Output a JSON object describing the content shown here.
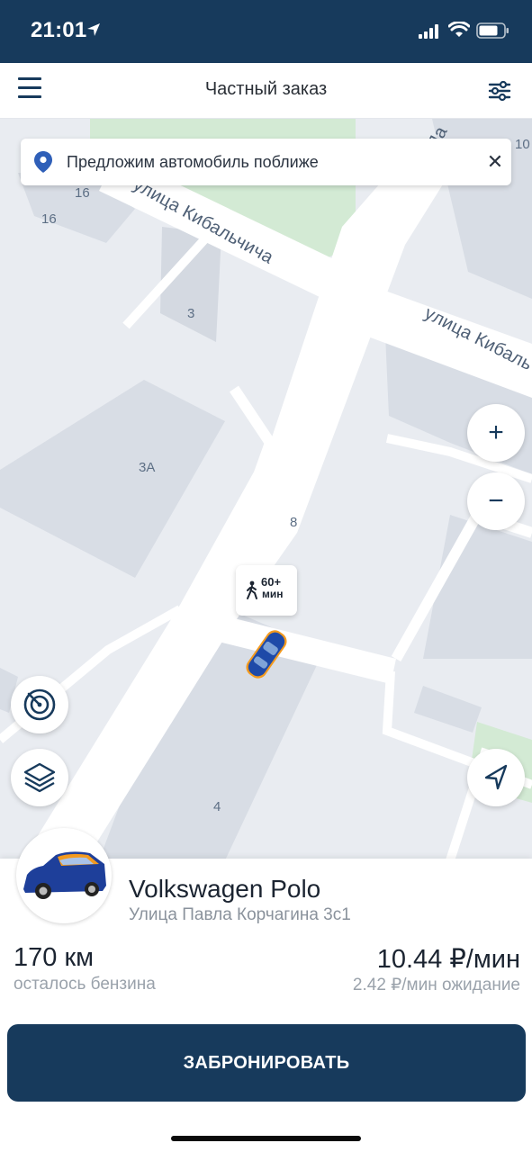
{
  "status_bar": {
    "time": "21:01"
  },
  "header": {
    "title": "Частный заказ"
  },
  "banner": {
    "text": "Предложим автомобиль поближе",
    "close_glyph": "✕"
  },
  "map": {
    "street_labels": [
      "улица Кибальчича",
      "улица Кибаль"
    ],
    "edge_street_label": "Па",
    "house_numbers": [
      "16",
      "16",
      "3",
      "3А",
      "8",
      "4",
      "10"
    ],
    "zoom_in_label": "+",
    "zoom_out_label": "−",
    "walk_badge": {
      "value": "60+",
      "unit": "мин"
    }
  },
  "car": {
    "name": "Volkswagen Polo",
    "address": "Улица Павла Корчагина 3с1",
    "range_value": "170 км",
    "range_label": "осталось бензина",
    "price_value": "10.44 ₽/мин",
    "price_wait": "2.42 ₽/мин ожидание"
  },
  "book_button": {
    "label": "ЗАБРОНИРОВАТЬ"
  },
  "colors": {
    "brand": "#173a5c",
    "car_blue": "#1e4aa8",
    "car_orange": "#f39a1e",
    "map_bg": "#e9ecf1",
    "park_green": "#cfe8d0"
  }
}
